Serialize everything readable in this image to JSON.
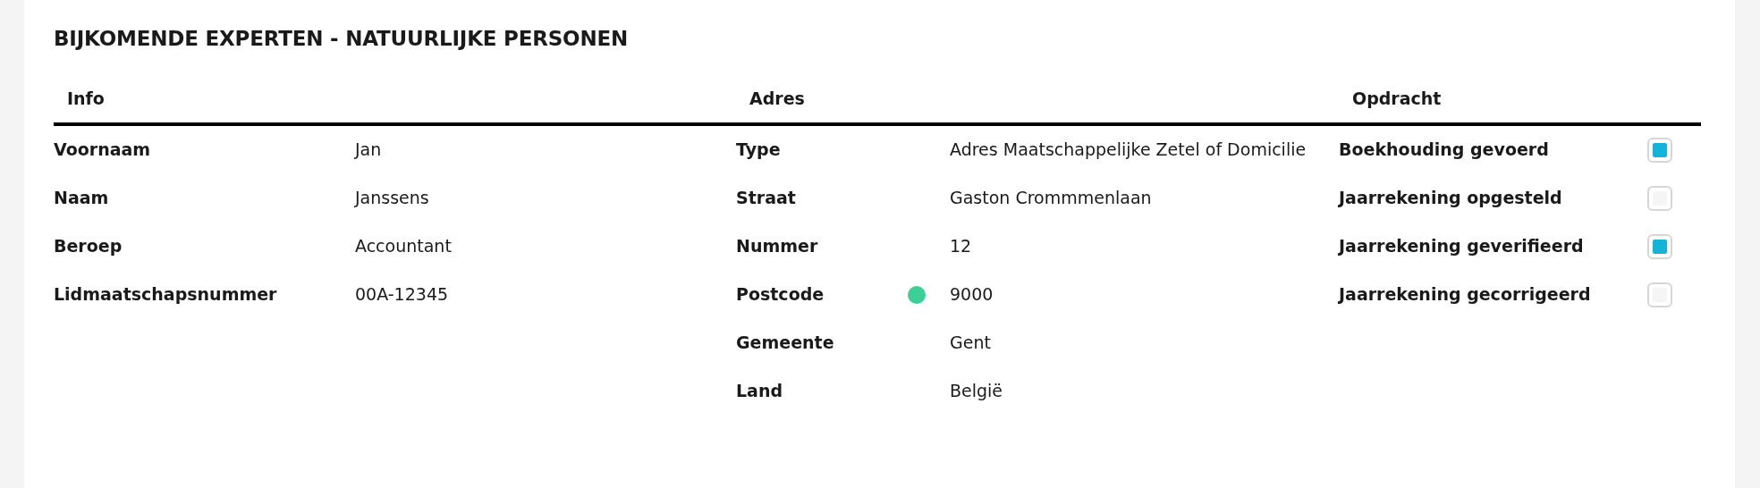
{
  "title": "BIJKOMENDE EXPERTEN - NATUURLIJKE PERSONEN",
  "sections": [
    {
      "heading": "Info",
      "rows": [
        {
          "kind": "text",
          "label": "Voornaam",
          "value": "Jan"
        },
        {
          "kind": "text",
          "label": "Naam",
          "value": "Janssens"
        },
        {
          "kind": "text",
          "label": "Beroep",
          "value": "Accountant"
        },
        {
          "kind": "text",
          "label": "Lidmaatschapsnummer",
          "value": "00A-12345"
        }
      ]
    },
    {
      "heading": "Adres",
      "rows": [
        {
          "kind": "text",
          "label": "Type",
          "value": "Adres Maatschappelijke Zetel of Domicilie"
        },
        {
          "kind": "text",
          "label": "Straat",
          "value": "Gaston Crommmenlaan"
        },
        {
          "kind": "text",
          "label": "Nummer",
          "value": "12"
        },
        {
          "kind": "text",
          "label": "Postcode",
          "value": "9000",
          "color": "#3ccf96"
        },
        {
          "kind": "text",
          "label": "Gemeente",
          "value": "Gent"
        },
        {
          "kind": "text",
          "label": "Land",
          "value": "België"
        }
      ]
    },
    {
      "heading": "Opdracht",
      "rows": [
        {
          "kind": "checkbox",
          "label": "Boekhouding gevoerd",
          "checked": true
        },
        {
          "kind": "checkbox",
          "label": "Jaarrekening opgesteld",
          "checked": false
        },
        {
          "kind": "checkbox",
          "label": "Jaarrekening geverifieerd",
          "checked": true
        },
        {
          "kind": "checkbox",
          "label": "Jaarrekening gecorrigeerd",
          "checked": false
        }
      ]
    }
  ]
}
